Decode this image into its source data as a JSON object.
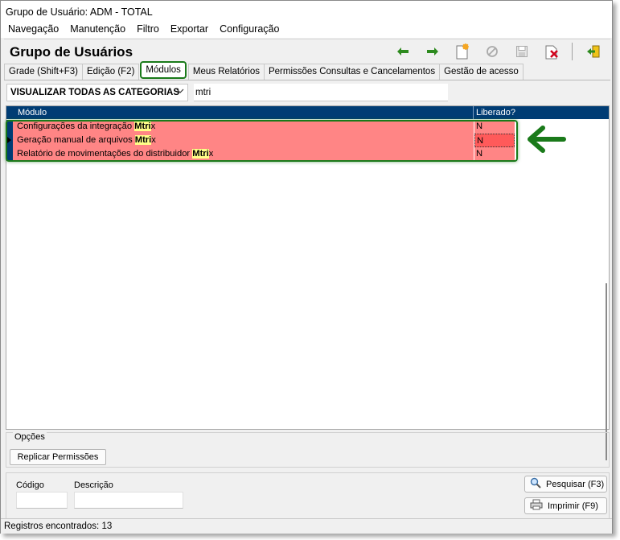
{
  "window": {
    "title": "Grupo de Usuário: ADM - TOTAL"
  },
  "menu": {
    "items": [
      "Navegação",
      "Manutenção",
      "Filtro",
      "Exportar",
      "Configuração"
    ]
  },
  "header": {
    "title": "Grupo de Usuários"
  },
  "toolbar": {
    "icons": [
      "arrow-left-icon",
      "arrow-right-icon",
      "new-document-icon",
      "cancel-icon",
      "save-icon",
      "delete-icon",
      "exit-icon"
    ],
    "colors": {
      "arrow": "#2d8a1e",
      "new": "#f5a623",
      "delete": "#d0021b"
    }
  },
  "tabs": [
    {
      "label": "Grade (Shift+F3)"
    },
    {
      "label": "Edição (F2)"
    },
    {
      "label": "Módulos"
    },
    {
      "label": "Meus Relatórios"
    },
    {
      "label": "Permissões Consultas e Cancelamentos"
    },
    {
      "label": "Gestão de acesso"
    }
  ],
  "active_tab": "Módulos",
  "filter": {
    "category": "VISUALIZAR TODAS AS CATEGORIAS",
    "search_value": "mtri"
  },
  "grid": {
    "columns": [
      "Módulo",
      "Liberado?"
    ],
    "rows": [
      {
        "prefix": "Configurações da integração ",
        "match": "Mtri",
        "suffix": "x",
        "liberado": "N"
      },
      {
        "prefix": "Geração manual de arquivos ",
        "match": "Mtri",
        "suffix": "x",
        "liberado": "N"
      },
      {
        "prefix": "Relatório de movimentações do distribuidor ",
        "match": "Mtri",
        "suffix": "x",
        "liberado": "N"
      }
    ],
    "colors": {
      "row_bg": "#ff8585",
      "header_bg": "#003c74",
      "highlight": "#ffff88",
      "annotation": "#1a7a1a"
    }
  },
  "options": {
    "title": "Opções",
    "replicar_label": "Replicar Permissões"
  },
  "bottom": {
    "codigo_label": "Código",
    "descricao_label": "Descrição",
    "pesquisar_label": "Pesquisar (F3)",
    "imprimir_label": "Imprimir (F9)"
  },
  "status": {
    "text": "Registros encontrados: 13"
  }
}
